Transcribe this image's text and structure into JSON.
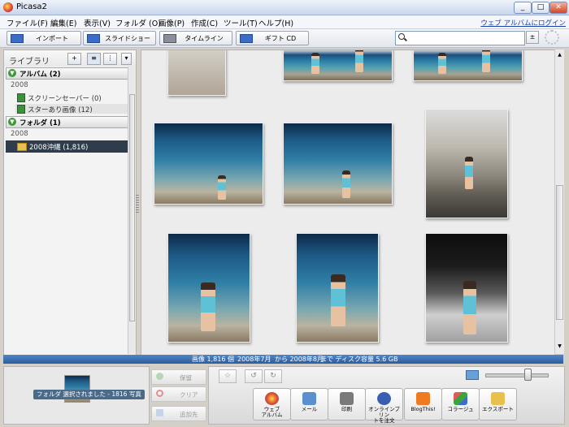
{
  "window": {
    "title": "Picasa2",
    "min": "_",
    "max": "□",
    "close": "✕"
  },
  "menu": {
    "items": [
      "ファイル(F)",
      "編集(E)",
      "表示(V)",
      "フォルダ (O)",
      "画像(P)",
      "作成(C)",
      "ツール(T)",
      "ヘルプ(H)"
    ],
    "login": "ウェブ アルバムにログイン"
  },
  "toolbar": {
    "import": "インポート",
    "slideshow": "スライドショー",
    "timeline": "タイムライン",
    "giftcd": "ギフト CD",
    "search_value": "",
    "clear": "±"
  },
  "sidebar": {
    "title": "ライブラリ",
    "add": "+",
    "albums_header": "アルバム (2)",
    "albums_year": "2008",
    "albums": [
      {
        "label": "スクリーンセーバー (0)"
      },
      {
        "label": "スターあり画像 (12)"
      }
    ],
    "folders_header": "フォルダ (1)",
    "folders_year": "2008",
    "folder_selected": "2008沖縄 (1,816)"
  },
  "status": {
    "images": "画像 1,816 個",
    "from": "2008年7月",
    "to_prefix": "から 2008年8月",
    "disk": "まで ディスク容量 5.6 GB"
  },
  "tray": {
    "label": "フォルダ 選択されました - 1816 写真",
    "hold": "保留",
    "clear": "クリア",
    "add": "追加先"
  },
  "actions": [
    {
      "id": "webalbum",
      "label": "ウェブ\nアルバム",
      "color": "#e8b23a"
    },
    {
      "id": "mail",
      "label": "メール",
      "color": "#5a8fd0"
    },
    {
      "id": "print",
      "label": "印刷",
      "color": "#7a7a7a"
    },
    {
      "id": "order",
      "label": "オンラインプリン\nトを注文",
      "color": "#3b5fb0"
    },
    {
      "id": "blogthis",
      "label": "BlogThis!",
      "color": "#f07a20"
    },
    {
      "id": "collage",
      "label": "コラージュ",
      "color": "#c85a8a"
    },
    {
      "id": "export",
      "label": "エクスポート",
      "color": "#4a9ac8"
    }
  ],
  "colors": {
    "status_bar": "#2c5d9e",
    "selected_folder": "#2e3c4c",
    "link": "#1a3fb0"
  }
}
